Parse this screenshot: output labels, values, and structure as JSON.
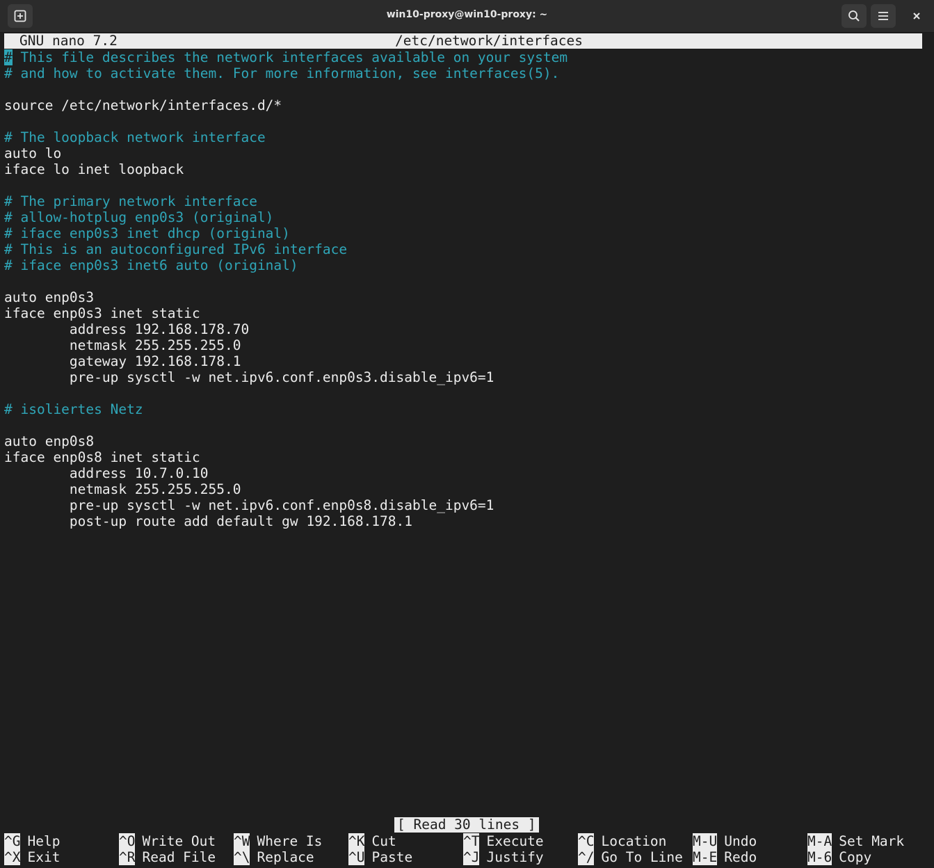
{
  "window": {
    "title": "win10-proxy@win10-proxy: ~",
    "new_tab_icon": "new-tab-icon",
    "search_icon": "search-icon",
    "menu_icon": "hamburger-menu-icon",
    "close_icon": "close-icon"
  },
  "nano": {
    "version": "GNU nano 7.2",
    "filename": "/etc/network/interfaces",
    "status": "[ Read 30 lines ]"
  },
  "colors": {
    "comment": "#2fa6b8",
    "text": "#ececec",
    "background": "#1e1e1e",
    "titlebar": "#2b2b2b"
  },
  "file": {
    "first_char": "#",
    "lines": [
      " This file describes the network interfaces available on your system",
      "# and how to activate them. For more information, see interfaces(5).",
      "",
      "source /etc/network/interfaces.d/*",
      "",
      "# The loopback network interface",
      "auto lo",
      "iface lo inet loopback",
      "",
      "# The primary network interface",
      "# allow-hotplug enp0s3 (original)",
      "# iface enp0s3 inet dhcp (original)",
      "# This is an autoconfigured IPv6 interface",
      "# iface enp0s3 inet6 auto (original)",
      "",
      "auto enp0s3",
      "iface enp0s3 inet static",
      "        address 192.168.178.70",
      "        netmask 255.255.255.0",
      "        gateway 192.168.178.1",
      "        pre-up sysctl -w net.ipv6.conf.enp0s3.disable_ipv6=1",
      "",
      "# isoliertes Netz",
      "",
      "auto enp0s8",
      "iface enp0s8 inet static",
      "        address 10.7.0.10",
      "        netmask 255.255.255.0",
      "        pre-up sysctl -w net.ipv6.conf.enp0s8.disable_ipv6=1",
      "        post-up route add default gw 192.168.178.1"
    ]
  },
  "shortcuts": {
    "row1": [
      {
        "key": "^G",
        "label": "Help"
      },
      {
        "key": "^O",
        "label": "Write Out"
      },
      {
        "key": "^W",
        "label": "Where Is"
      },
      {
        "key": "^K",
        "label": "Cut"
      },
      {
        "key": "^T",
        "label": "Execute"
      },
      {
        "key": "^C",
        "label": "Location"
      },
      {
        "key": "M-U",
        "label": "Undo"
      },
      {
        "key": "M-A",
        "label": "Set Mark"
      }
    ],
    "row2": [
      {
        "key": "^X",
        "label": "Exit"
      },
      {
        "key": "^R",
        "label": "Read File"
      },
      {
        "key": "^\\",
        "label": "Replace"
      },
      {
        "key": "^U",
        "label": "Paste"
      },
      {
        "key": "^J",
        "label": "Justify"
      },
      {
        "key": "^/",
        "label": "Go To Line"
      },
      {
        "key": "M-E",
        "label": "Redo"
      },
      {
        "key": "M-6",
        "label": "Copy"
      }
    ]
  }
}
